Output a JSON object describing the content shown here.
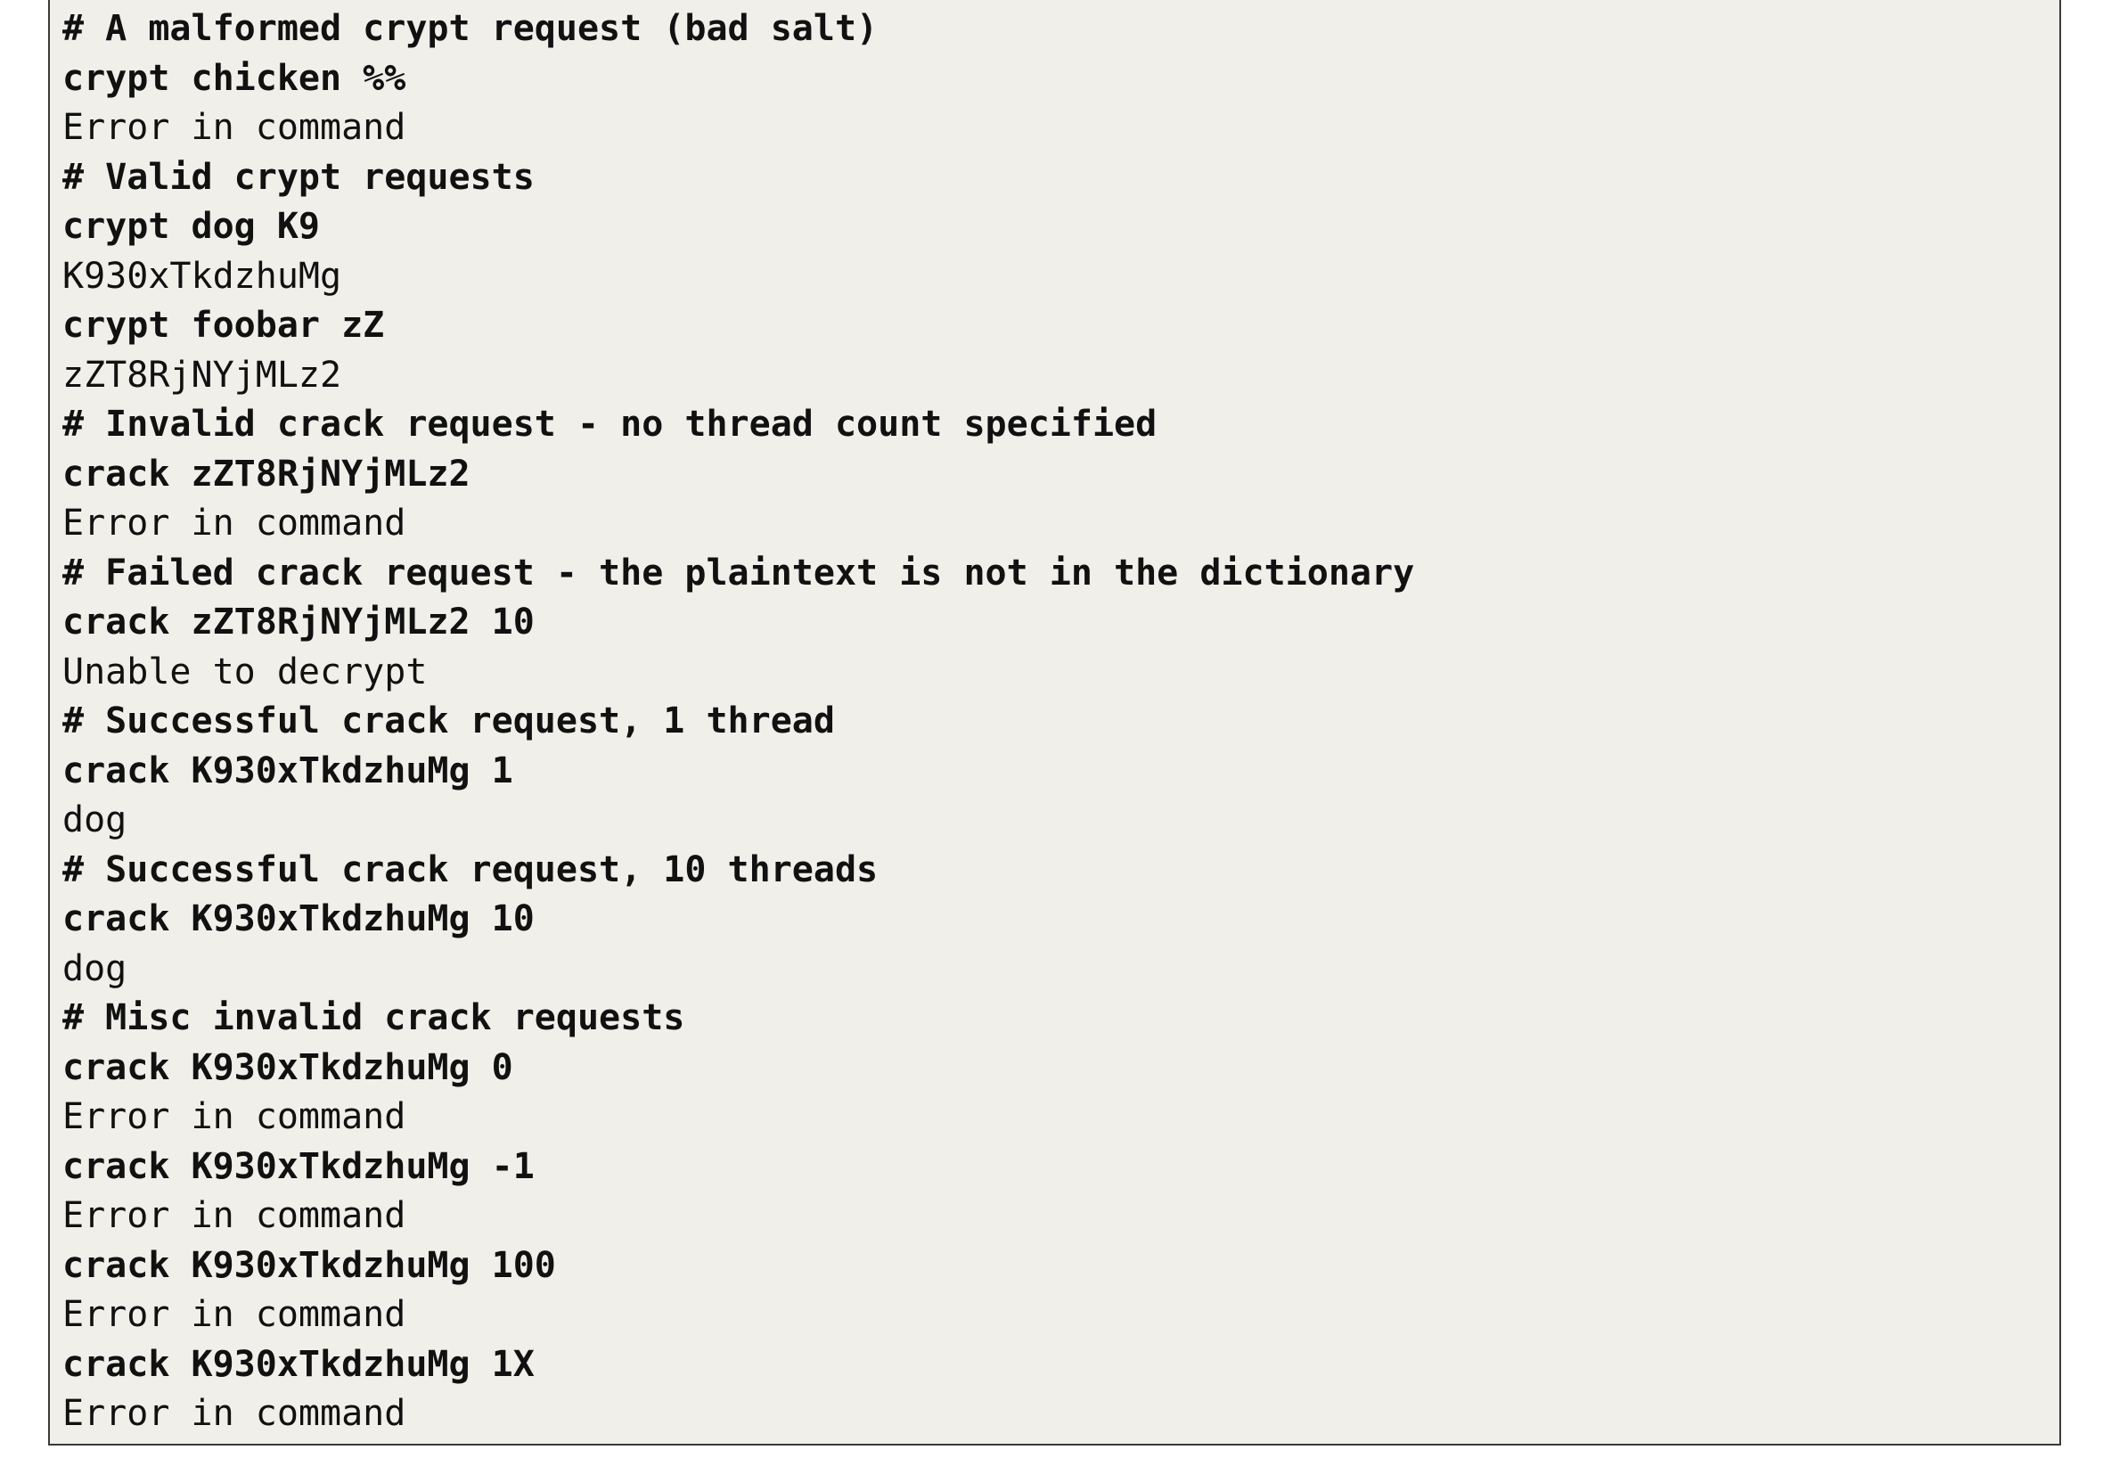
{
  "lines": [
    {
      "text": "# A malformed crypt request (bad salt)",
      "kind": "comment"
    },
    {
      "text": "crypt chicken %%",
      "kind": "command"
    },
    {
      "text": "Error in command",
      "kind": "output"
    },
    {
      "text": "# Valid crypt requests",
      "kind": "comment"
    },
    {
      "text": "crypt dog K9",
      "kind": "command"
    },
    {
      "text": "K930xTkdzhuMg",
      "kind": "output"
    },
    {
      "text": "crypt foobar zZ",
      "kind": "command"
    },
    {
      "text": "zZT8RjNYjMLz2",
      "kind": "output"
    },
    {
      "text": "# Invalid crack request - no thread count specified",
      "kind": "comment"
    },
    {
      "text": "crack zZT8RjNYjMLz2",
      "kind": "command"
    },
    {
      "text": "Error in command",
      "kind": "output"
    },
    {
      "text": "# Failed crack request - the plaintext is not in the dictionary",
      "kind": "comment"
    },
    {
      "text": "crack zZT8RjNYjMLz2 10",
      "kind": "command"
    },
    {
      "text": "Unable to decrypt",
      "kind": "output"
    },
    {
      "text": "# Successful crack request, 1 thread",
      "kind": "comment"
    },
    {
      "text": "crack K930xTkdzhuMg 1",
      "kind": "command"
    },
    {
      "text": "dog",
      "kind": "output"
    },
    {
      "text": "# Successful crack request, 10 threads",
      "kind": "comment"
    },
    {
      "text": "crack K930xTkdzhuMg 10",
      "kind": "command"
    },
    {
      "text": "dog",
      "kind": "output"
    },
    {
      "text": "# Misc invalid crack requests",
      "kind": "comment"
    },
    {
      "text": "crack K930xTkdzhuMg 0",
      "kind": "command"
    },
    {
      "text": "Error in command",
      "kind": "output"
    },
    {
      "text": "crack K930xTkdzhuMg -1",
      "kind": "command"
    },
    {
      "text": "Error in command",
      "kind": "output"
    },
    {
      "text": "crack K930xTkdzhuMg 100",
      "kind": "command"
    },
    {
      "text": "Error in command",
      "kind": "output"
    },
    {
      "text": "crack K930xTkdzhuMg 1X",
      "kind": "command"
    },
    {
      "text": "Error in command",
      "kind": "output"
    }
  ]
}
